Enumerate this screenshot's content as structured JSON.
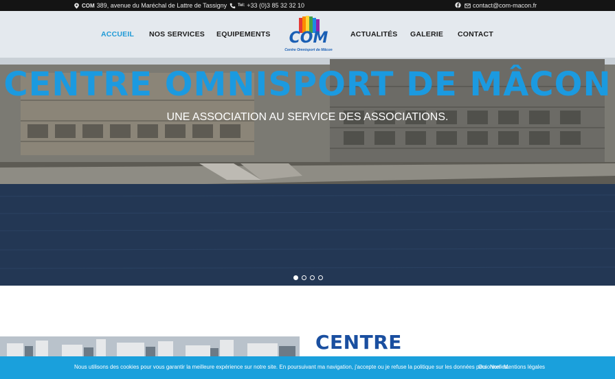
{
  "topbar": {
    "address_brand": "COM",
    "address": "389, avenue du Maréchal de Lattre de Tassigny",
    "tel_label": "Tel:",
    "tel": "+33 (0)3 85 32 32 10",
    "email": "contact@com-macon.fr",
    "icons": [
      "map-pin-icon",
      "phone-icon",
      "facebook-icon",
      "envelope-icon"
    ]
  },
  "nav": {
    "items": [
      {
        "label": "ACCUEIL",
        "active": true
      },
      {
        "label": "NOS SERVICES",
        "active": false
      },
      {
        "label": "EQUIPEMENTS",
        "active": false
      },
      {
        "label": "ACTUALITÉS",
        "active": false
      },
      {
        "label": "GALERIE",
        "active": false
      },
      {
        "label": "CONTACT",
        "active": false
      }
    ],
    "logo_text": "COM",
    "logo_subtitle": "Centre Omnisport de Mâcon"
  },
  "hero": {
    "title": "CENTRE OMNISPORT DE MÂCON",
    "subtitle": "UNE ASSOCIATION AU SERVICE DES ASSOCIATIONS.",
    "slides": 4,
    "active_slide": 1
  },
  "section": {
    "title": "CENTRE"
  },
  "cookie": {
    "text": "Nous utilisons des cookies pour vous garantir la meilleure expérience sur notre site. En poursuivant ma navigation, j'accepte ou je refuse la politique sur les données personnelles.",
    "accept": "Oui",
    "refuse": "Non",
    "legal": "Mentions légales"
  },
  "colors": {
    "accent": "#1f9ad6",
    "hero_title": "#1b9ae0",
    "section_title": "#1a4fa0",
    "cookie_bg": "#1aa0dc",
    "topbar_bg": "#141414"
  }
}
